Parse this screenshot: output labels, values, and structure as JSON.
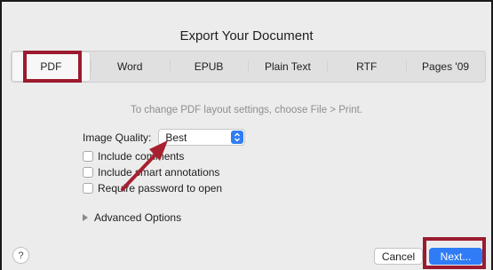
{
  "dialog": {
    "title": "Export Your Document"
  },
  "tabs": [
    {
      "label": "PDF",
      "selected": true
    },
    {
      "label": "Word",
      "selected": false
    },
    {
      "label": "EPUB",
      "selected": false
    },
    {
      "label": "Plain Text",
      "selected": false
    },
    {
      "label": "RTF",
      "selected": false
    },
    {
      "label": "Pages '09",
      "selected": false
    }
  ],
  "hint": "To change PDF layout settings, choose File > Print.",
  "image_quality": {
    "label": "Image Quality:",
    "value": "Best"
  },
  "options": [
    {
      "label": "Include comments",
      "checked": false
    },
    {
      "label": "Include smart annotations",
      "checked": false
    },
    {
      "label": "Require password to open",
      "checked": false
    }
  ],
  "advanced": {
    "label": "Advanced Options"
  },
  "footer": {
    "help_label": "?",
    "cancel_label": "Cancel",
    "next_label": "Next..."
  },
  "colors": {
    "highlight": "#9b1b2e",
    "accent": "#2f7cf6"
  }
}
